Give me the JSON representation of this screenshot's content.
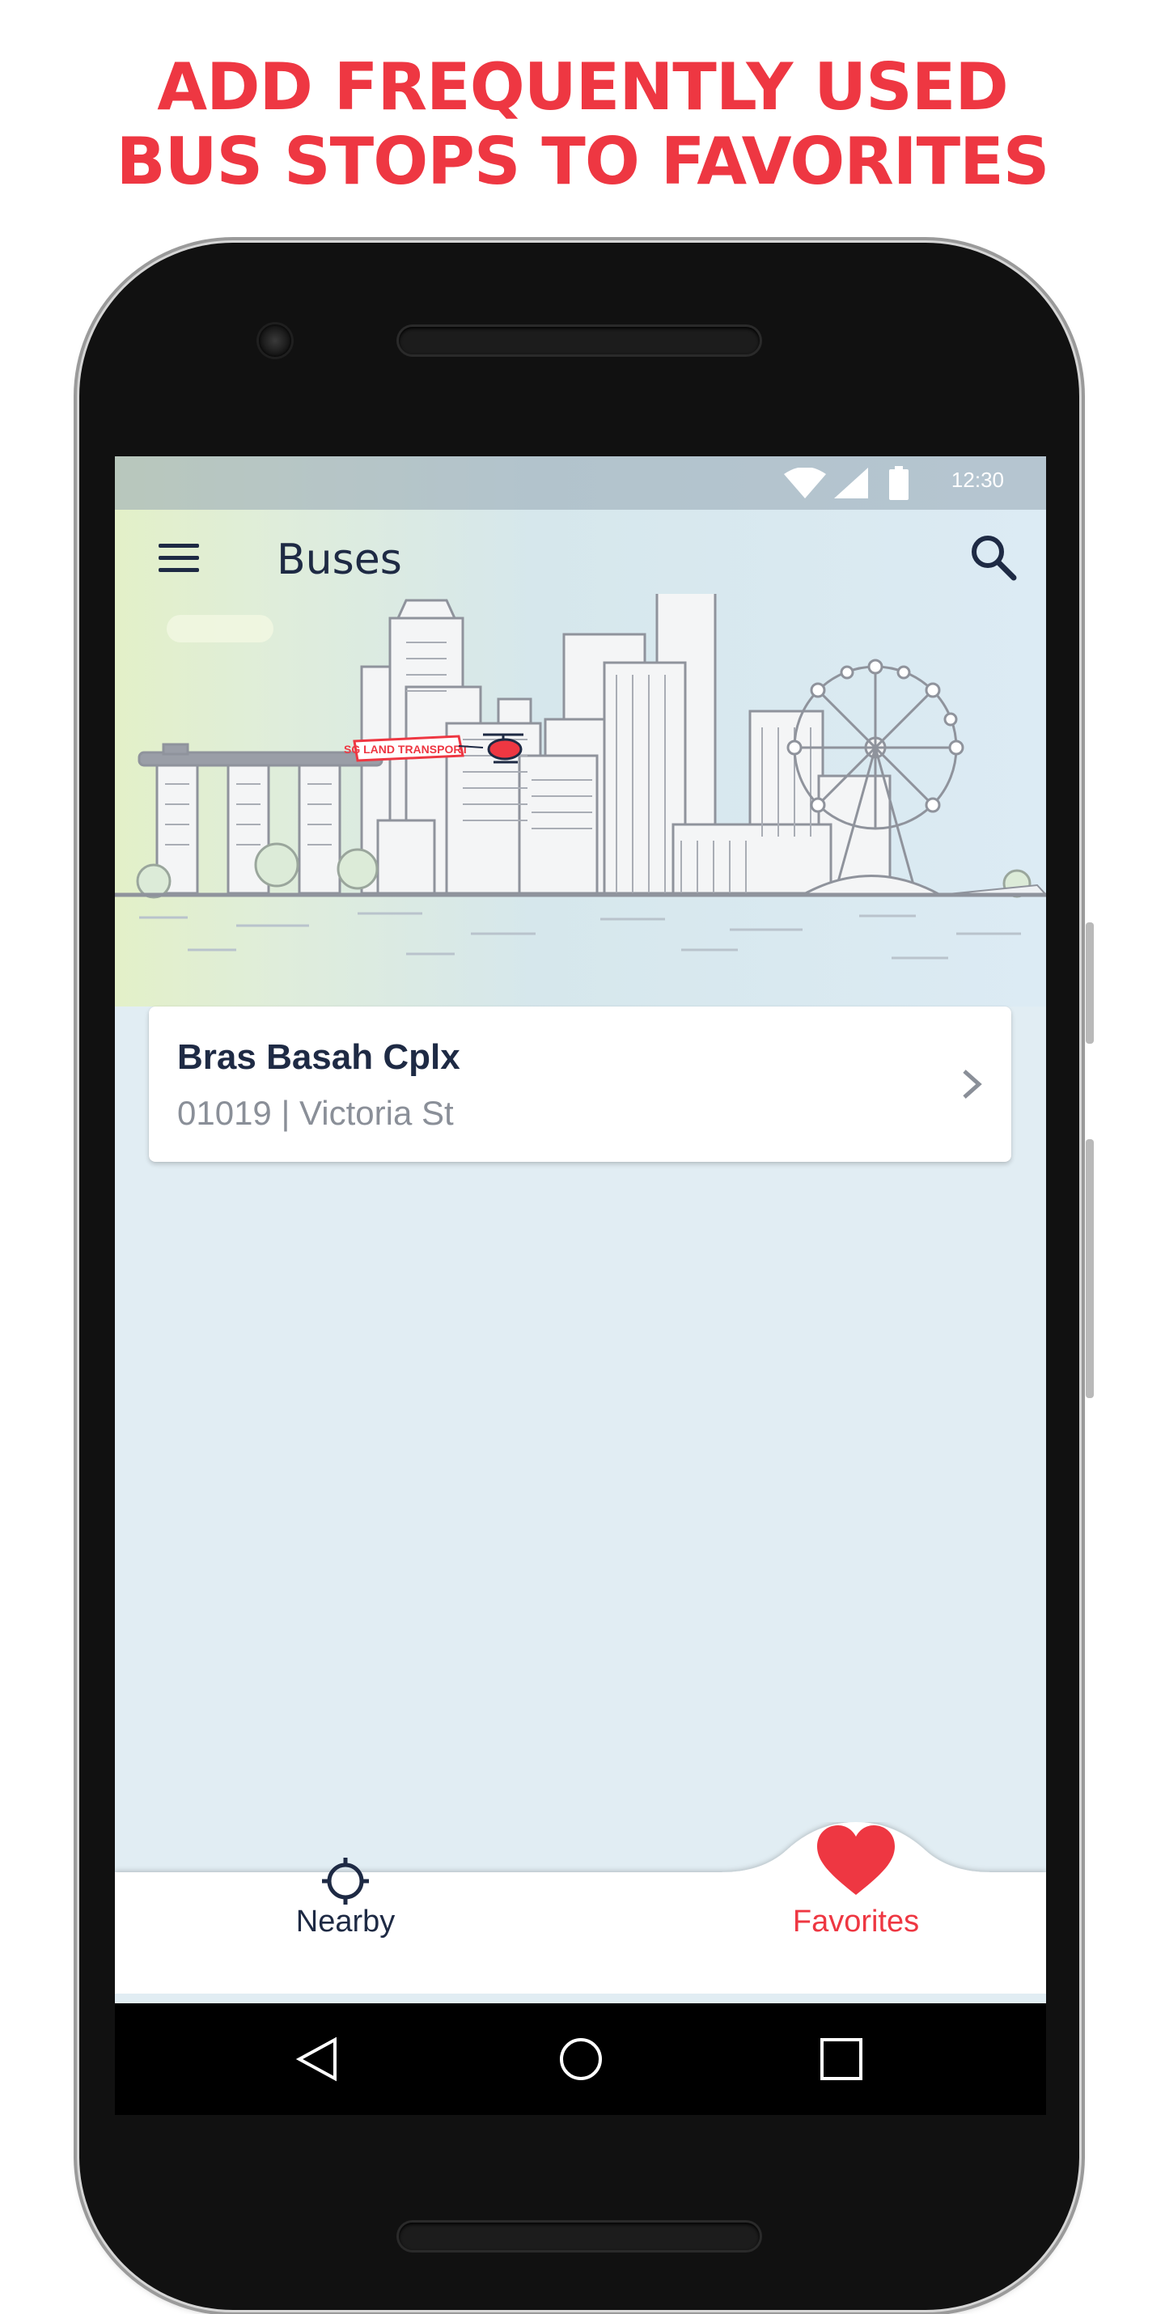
{
  "headline": {
    "line1": "ADD FREQUENTLY USED",
    "line2": "BUS STOPS TO FAVORITES"
  },
  "status_bar": {
    "time": "12:30",
    "icons": [
      "wifi-icon",
      "signal-icon",
      "battery-icon"
    ]
  },
  "app_bar": {
    "title": "Buses",
    "menu_icon": "menu-icon",
    "search_icon": "search-icon"
  },
  "banner": {
    "flag_text": "SG LAND TRANSPORT"
  },
  "favorites": [
    {
      "name": "Bras Basah Cplx",
      "detail": "01019 | Victoria St"
    }
  ],
  "bottom_nav": {
    "items": [
      {
        "label": "Nearby",
        "icon": "crosshair-icon",
        "active": false
      },
      {
        "label": "Favorites",
        "icon": "heart-icon",
        "active": true
      }
    ]
  },
  "system_nav": [
    "back-icon",
    "home-icon",
    "recents-icon"
  ],
  "colors": {
    "accent_red": "#ee3742",
    "navy": "#1e2a44",
    "screen_bg": "#e1edf3",
    "subtitle_gray": "#8a8f98"
  }
}
